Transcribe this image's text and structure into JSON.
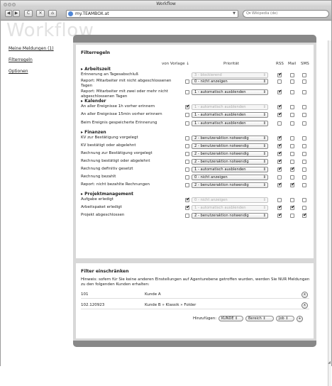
{
  "window": {
    "title": "Workflow"
  },
  "toolbar": {
    "back": "◀",
    "forward": "▶",
    "reload": "C",
    "stop": "✕",
    "home": "⌂",
    "url": "my.TEAMBOX.at",
    "url_dropdown": "▼",
    "search_placeholder": "Q▾ Wikipedia (de)"
  },
  "brand": "Workflow",
  "sidebar": {
    "items": [
      {
        "label": "Meine Meldungen (1)"
      },
      {
        "label": "Filterregeln"
      },
      {
        "label": "Optionen"
      }
    ]
  },
  "filterregeln": {
    "title": "Filterregeln",
    "col_vorlage": "von Vorlage ↓",
    "col_prioritaet": "Priorität",
    "col_rss": "RSS",
    "col_mail": "Mail",
    "col_sms": "SMS",
    "sections": [
      {
        "title": "▸ Arbeitszeit"
      },
      {
        "title": "▸ Kalender"
      },
      {
        "title": "▸ Finanzen"
      },
      {
        "title": "▸ Projektmanagement"
      }
    ],
    "rows": [
      {
        "label": "Erinnerung an Tagesabschluß",
        "vorlage": false,
        "show_vorlage": false,
        "priority": "3 - blockierend",
        "disabled": true,
        "rss": true,
        "mail": false,
        "sms": false
      },
      {
        "label": "Report: Mitarbeiter mit nicht abgeschlossenen Tagen",
        "vorlage": false,
        "show_vorlage": true,
        "priority": "0 - nicht anzeigen",
        "disabled": false,
        "rss": false,
        "mail": false,
        "sms": false
      },
      {
        "label": "Report: Mitarbeiter mit zwei oder mehr nicht abgeschlossenen Tagen",
        "vorlage": false,
        "show_vorlage": true,
        "priority": "1 - automatisch ausblenden",
        "disabled": false,
        "rss": true,
        "mail": false,
        "sms": false
      },
      {
        "label": "An aller Ereignisse 1h vorher erinnern",
        "vorlage": true,
        "show_vorlage": true,
        "priority": "1 - automatisch ausblenden",
        "disabled": true,
        "rss": true,
        "mail": false,
        "sms": false
      },
      {
        "label": "An aller Ereignisse 15min vorher erinnern",
        "vorlage": false,
        "show_vorlage": true,
        "priority": "1 - automatisch ausblenden",
        "disabled": false,
        "rss": true,
        "mail": false,
        "sms": false
      },
      {
        "label": "Beim Ereignis gespeicherte Erinnerung",
        "vorlage": false,
        "show_vorlage": true,
        "priority": "1 - automatisch ausblenden",
        "disabled": false,
        "rss": false,
        "mail": false,
        "sms": false
      },
      {
        "label": "KV zur Bestätigung vorgelegt",
        "vorlage": false,
        "show_vorlage": true,
        "priority": "2 - benutzeraktion notwendig",
        "disabled": false,
        "rss": true,
        "mail": false,
        "sms": false
      },
      {
        "label": "KV bestätigt oder abgelehnt",
        "vorlage": false,
        "show_vorlage": true,
        "priority": "2 - benutzeraktion notwendig",
        "disabled": false,
        "rss": true,
        "mail": false,
        "sms": false
      },
      {
        "label": "Rechnung zur Bestätigung vorgelegt",
        "vorlage": false,
        "show_vorlage": true,
        "priority": "2 - benutzeraktion notwendig",
        "disabled": false,
        "rss": true,
        "mail": false,
        "sms": false
      },
      {
        "label": "Rechnung bestätigt oder abgelehnt",
        "vorlage": false,
        "show_vorlage": true,
        "priority": "2 - benutzeraktion notwendig",
        "disabled": false,
        "rss": true,
        "mail": false,
        "sms": false
      },
      {
        "label": "Rechnung definitiv gesetzt",
        "vorlage": false,
        "show_vorlage": true,
        "priority": "1 - automatisch ausblenden",
        "disabled": false,
        "rss": true,
        "mail": true,
        "sms": false
      },
      {
        "label": "Rechnung bezahlt",
        "vorlage": false,
        "show_vorlage": true,
        "priority": "0 - nicht anzeigen",
        "disabled": false,
        "rss": false,
        "mail": false,
        "sms": false
      },
      {
        "label": "Report: nicht bezahlte Rechnungen",
        "vorlage": false,
        "show_vorlage": true,
        "priority": "2 - benutzeraktion notwendig",
        "disabled": false,
        "rss": true,
        "mail": true,
        "sms": false
      },
      {
        "label": "Aufgabe erledigt",
        "vorlage": true,
        "show_vorlage": true,
        "priority": "0 - nicht anzeigen",
        "disabled": true,
        "rss": false,
        "mail": false,
        "sms": false
      },
      {
        "label": "Arbeitspaket erledigt",
        "vorlage": true,
        "show_vorlage": true,
        "priority": "1 - automatisch ausblenden",
        "disabled": true,
        "rss": true,
        "mail": true,
        "sms": false
      },
      {
        "label": "Projekt abgeschlossen",
        "vorlage": false,
        "show_vorlage": true,
        "priority": "2 - benutzeraktion notwendig",
        "disabled": false,
        "rss": true,
        "mail": false,
        "sms": true
      }
    ]
  },
  "einschraenken": {
    "title": "Filter einschränken",
    "note": "Hinweis: sofern für Sie keine anderen Einstellungen auf Agenturebene getroffen wurden, werden Sie NUR Meldungen zu den folgenden Kunden erhalten:",
    "customers": [
      {
        "id": "101",
        "name": "Kunde A",
        "remove": "x"
      },
      {
        "id": "102.120923",
        "name": "Kunde B » Klassik » Folder",
        "remove": "x"
      }
    ],
    "add_label": "Hinzufügen:",
    "add_kunde": "KUNDE",
    "add_bereich": "Bereich",
    "add_job": "Job",
    "add_btn": "+"
  }
}
